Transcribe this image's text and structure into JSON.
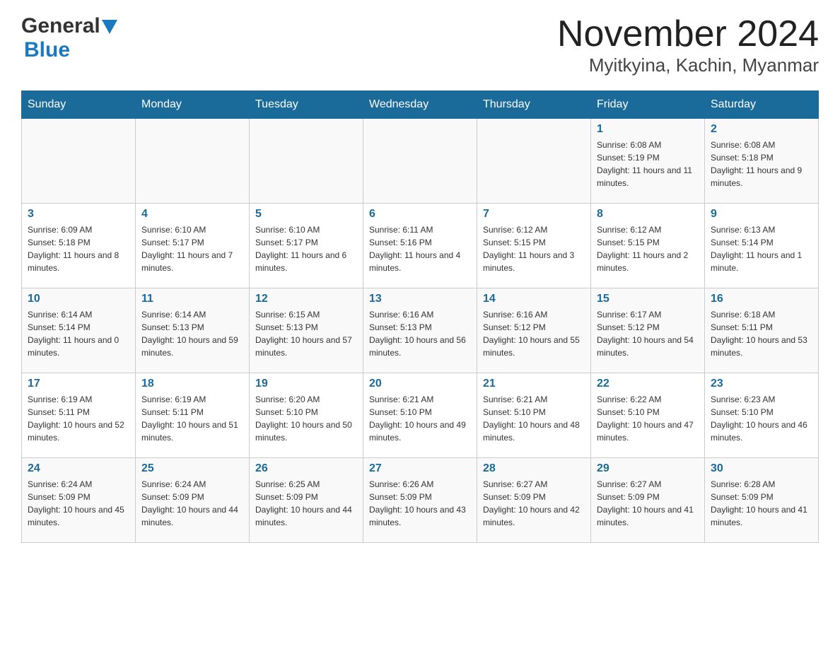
{
  "logo": {
    "general": "General",
    "blue": "Blue"
  },
  "title": {
    "month_year": "November 2024",
    "location": "Myitkyina, Kachin, Myanmar"
  },
  "weekdays": [
    "Sunday",
    "Monday",
    "Tuesday",
    "Wednesday",
    "Thursday",
    "Friday",
    "Saturday"
  ],
  "weeks": [
    [
      {
        "day": "",
        "info": ""
      },
      {
        "day": "",
        "info": ""
      },
      {
        "day": "",
        "info": ""
      },
      {
        "day": "",
        "info": ""
      },
      {
        "day": "",
        "info": ""
      },
      {
        "day": "1",
        "info": "Sunrise: 6:08 AM\nSunset: 5:19 PM\nDaylight: 11 hours and 11 minutes."
      },
      {
        "day": "2",
        "info": "Sunrise: 6:08 AM\nSunset: 5:18 PM\nDaylight: 11 hours and 9 minutes."
      }
    ],
    [
      {
        "day": "3",
        "info": "Sunrise: 6:09 AM\nSunset: 5:18 PM\nDaylight: 11 hours and 8 minutes."
      },
      {
        "day": "4",
        "info": "Sunrise: 6:10 AM\nSunset: 5:17 PM\nDaylight: 11 hours and 7 minutes."
      },
      {
        "day": "5",
        "info": "Sunrise: 6:10 AM\nSunset: 5:17 PM\nDaylight: 11 hours and 6 minutes."
      },
      {
        "day": "6",
        "info": "Sunrise: 6:11 AM\nSunset: 5:16 PM\nDaylight: 11 hours and 4 minutes."
      },
      {
        "day": "7",
        "info": "Sunrise: 6:12 AM\nSunset: 5:15 PM\nDaylight: 11 hours and 3 minutes."
      },
      {
        "day": "8",
        "info": "Sunrise: 6:12 AM\nSunset: 5:15 PM\nDaylight: 11 hours and 2 minutes."
      },
      {
        "day": "9",
        "info": "Sunrise: 6:13 AM\nSunset: 5:14 PM\nDaylight: 11 hours and 1 minute."
      }
    ],
    [
      {
        "day": "10",
        "info": "Sunrise: 6:14 AM\nSunset: 5:14 PM\nDaylight: 11 hours and 0 minutes."
      },
      {
        "day": "11",
        "info": "Sunrise: 6:14 AM\nSunset: 5:13 PM\nDaylight: 10 hours and 59 minutes."
      },
      {
        "day": "12",
        "info": "Sunrise: 6:15 AM\nSunset: 5:13 PM\nDaylight: 10 hours and 57 minutes."
      },
      {
        "day": "13",
        "info": "Sunrise: 6:16 AM\nSunset: 5:13 PM\nDaylight: 10 hours and 56 minutes."
      },
      {
        "day": "14",
        "info": "Sunrise: 6:16 AM\nSunset: 5:12 PM\nDaylight: 10 hours and 55 minutes."
      },
      {
        "day": "15",
        "info": "Sunrise: 6:17 AM\nSunset: 5:12 PM\nDaylight: 10 hours and 54 minutes."
      },
      {
        "day": "16",
        "info": "Sunrise: 6:18 AM\nSunset: 5:11 PM\nDaylight: 10 hours and 53 minutes."
      }
    ],
    [
      {
        "day": "17",
        "info": "Sunrise: 6:19 AM\nSunset: 5:11 PM\nDaylight: 10 hours and 52 minutes."
      },
      {
        "day": "18",
        "info": "Sunrise: 6:19 AM\nSunset: 5:11 PM\nDaylight: 10 hours and 51 minutes."
      },
      {
        "day": "19",
        "info": "Sunrise: 6:20 AM\nSunset: 5:10 PM\nDaylight: 10 hours and 50 minutes."
      },
      {
        "day": "20",
        "info": "Sunrise: 6:21 AM\nSunset: 5:10 PM\nDaylight: 10 hours and 49 minutes."
      },
      {
        "day": "21",
        "info": "Sunrise: 6:21 AM\nSunset: 5:10 PM\nDaylight: 10 hours and 48 minutes."
      },
      {
        "day": "22",
        "info": "Sunrise: 6:22 AM\nSunset: 5:10 PM\nDaylight: 10 hours and 47 minutes."
      },
      {
        "day": "23",
        "info": "Sunrise: 6:23 AM\nSunset: 5:10 PM\nDaylight: 10 hours and 46 minutes."
      }
    ],
    [
      {
        "day": "24",
        "info": "Sunrise: 6:24 AM\nSunset: 5:09 PM\nDaylight: 10 hours and 45 minutes."
      },
      {
        "day": "25",
        "info": "Sunrise: 6:24 AM\nSunset: 5:09 PM\nDaylight: 10 hours and 44 minutes."
      },
      {
        "day": "26",
        "info": "Sunrise: 6:25 AM\nSunset: 5:09 PM\nDaylight: 10 hours and 44 minutes."
      },
      {
        "day": "27",
        "info": "Sunrise: 6:26 AM\nSunset: 5:09 PM\nDaylight: 10 hours and 43 minutes."
      },
      {
        "day": "28",
        "info": "Sunrise: 6:27 AM\nSunset: 5:09 PM\nDaylight: 10 hours and 42 minutes."
      },
      {
        "day": "29",
        "info": "Sunrise: 6:27 AM\nSunset: 5:09 PM\nDaylight: 10 hours and 41 minutes."
      },
      {
        "day": "30",
        "info": "Sunrise: 6:28 AM\nSunset: 5:09 PM\nDaylight: 10 hours and 41 minutes."
      }
    ]
  ]
}
